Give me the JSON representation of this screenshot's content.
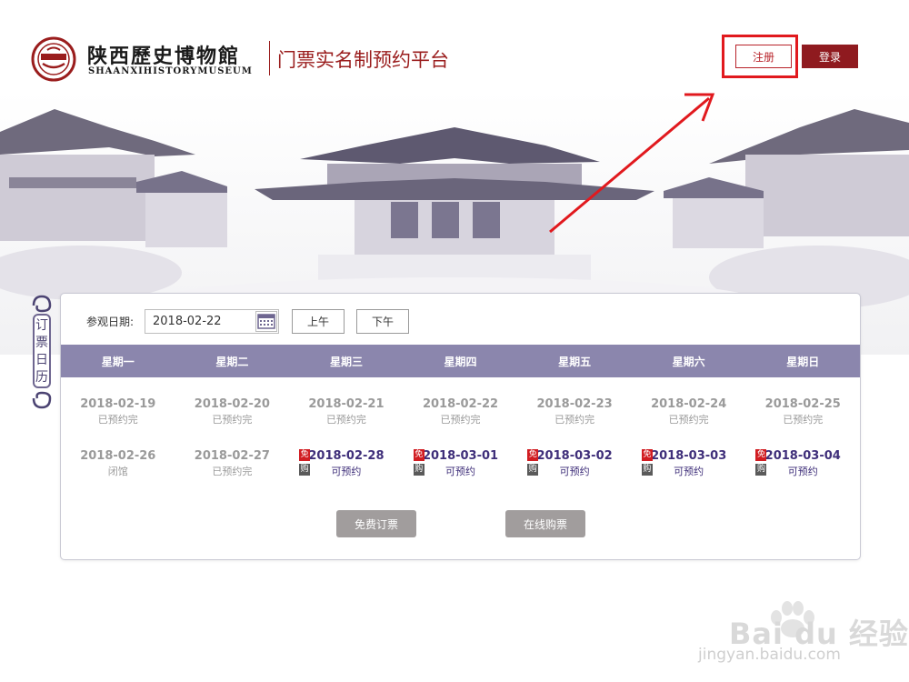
{
  "header": {
    "logo_cn": "陕西歷史博物館",
    "logo_en": "SHAANXIHISTORYMUSEUM",
    "platform_title": "门票实名制预约平台",
    "register_label": "注册",
    "login_label": "登录"
  },
  "side_tag": {
    "text": "订票日历"
  },
  "calendar": {
    "date_label": "参观日期:",
    "date_value": "2018-02-22",
    "am_label": "上午",
    "pm_label": "下午",
    "weekdays": [
      "星期一",
      "星期二",
      "星期三",
      "星期四",
      "星期五",
      "星期六",
      "星期日"
    ],
    "rows": [
      [
        {
          "date": "2018-02-19",
          "status": "已预约完"
        },
        {
          "date": "2018-02-20",
          "status": "已预约完"
        },
        {
          "date": "2018-02-21",
          "status": "已预约完"
        },
        {
          "date": "2018-02-22",
          "status": "已预约完"
        },
        {
          "date": "2018-02-23",
          "status": "已预约完"
        },
        {
          "date": "2018-02-24",
          "status": "已预约完"
        },
        {
          "date": "2018-02-25",
          "status": "已预约完"
        }
      ],
      [
        {
          "date": "2018-02-26",
          "status": "闭馆"
        },
        {
          "date": "2018-02-27",
          "status": "已预约完"
        },
        {
          "date": "2018-02-28",
          "status": "可预约",
          "free": "免",
          "buy": "购"
        },
        {
          "date": "2018-03-01",
          "status": "可预约",
          "free": "免",
          "buy": "购"
        },
        {
          "date": "2018-03-02",
          "status": "可预约",
          "free": "免",
          "buy": "购"
        },
        {
          "date": "2018-03-03",
          "status": "可预约",
          "free": "免",
          "buy": "购"
        },
        {
          "date": "2018-03-04",
          "status": "可预约",
          "free": "免",
          "buy": "购"
        }
      ]
    ],
    "free_ticket_label": "免费订票",
    "buy_online_label": "在线购票"
  },
  "colors": {
    "brand_red": "#8f1a1f",
    "highlight_red": "#e1191e",
    "header_purple": "#8b86ad",
    "available_text": "#3f2f7a"
  },
  "watermark": {
    "text": "Bai du 经验",
    "sub": "jingyan.baidu.com"
  }
}
